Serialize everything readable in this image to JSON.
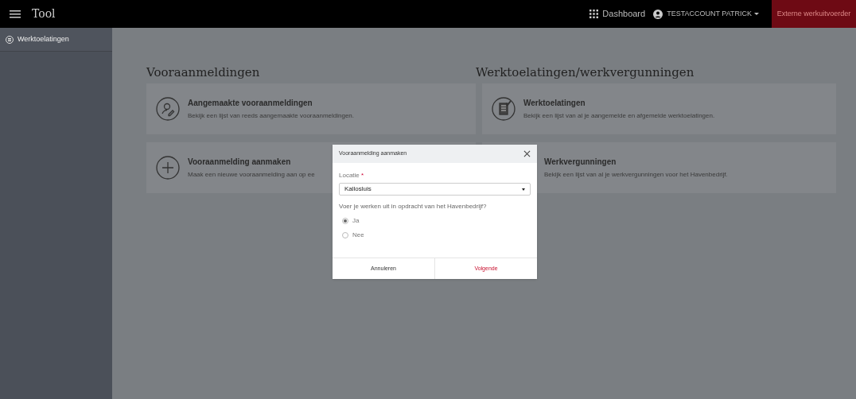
{
  "topbar": {
    "title": "Tool",
    "dashboard": "Dashboard",
    "user": "TESTACCOUNT PATRICK",
    "role": "Externe werkuitvoerder"
  },
  "sidebar": {
    "items": [
      {
        "label": "Werktoelatingen",
        "selected": true
      }
    ]
  },
  "sections": [
    {
      "title": "Vooraanmeldingen",
      "cards": [
        {
          "kind": "person",
          "title": "Aangemaakte vooraanmeldingen",
          "description": "Bekijk een lijst van reeds aangemaakte vooraanmeldingen."
        },
        {
          "kind": "plus",
          "title": "Vooraanmelding aanmaken",
          "description": "Maak een nieuwe vooraanmelding aan op ee"
        }
      ]
    },
    {
      "title": "Werktoelatingen/werkvergunningen",
      "cards": [
        {
          "kind": "document",
          "title": "Werktoelatingen",
          "description": "Bekijk een lijst van al je aangemelde en afgemelde werktoelatingen."
        },
        {
          "kind": "none",
          "title": "Werkvergunningen",
          "description": "Bekijk een lijst van al je werkvergunningen voor het Havenbedrijf."
        }
      ]
    }
  ],
  "dialog": {
    "title": "Vooraanmelding aanmaken",
    "field_label": "Locatie",
    "required_mark": "*",
    "field_value": "Kallosluis",
    "question": "Voer je werken uit in opdracht van het Havenbedrijf?",
    "options": [
      {
        "label": "Ja",
        "selected": true
      },
      {
        "label": "Nee",
        "selected": false
      }
    ],
    "buttons": [
      {
        "label": "Annuleren",
        "kind": "secondary"
      },
      {
        "label": "Volgende",
        "kind": "primary"
      }
    ]
  }
}
